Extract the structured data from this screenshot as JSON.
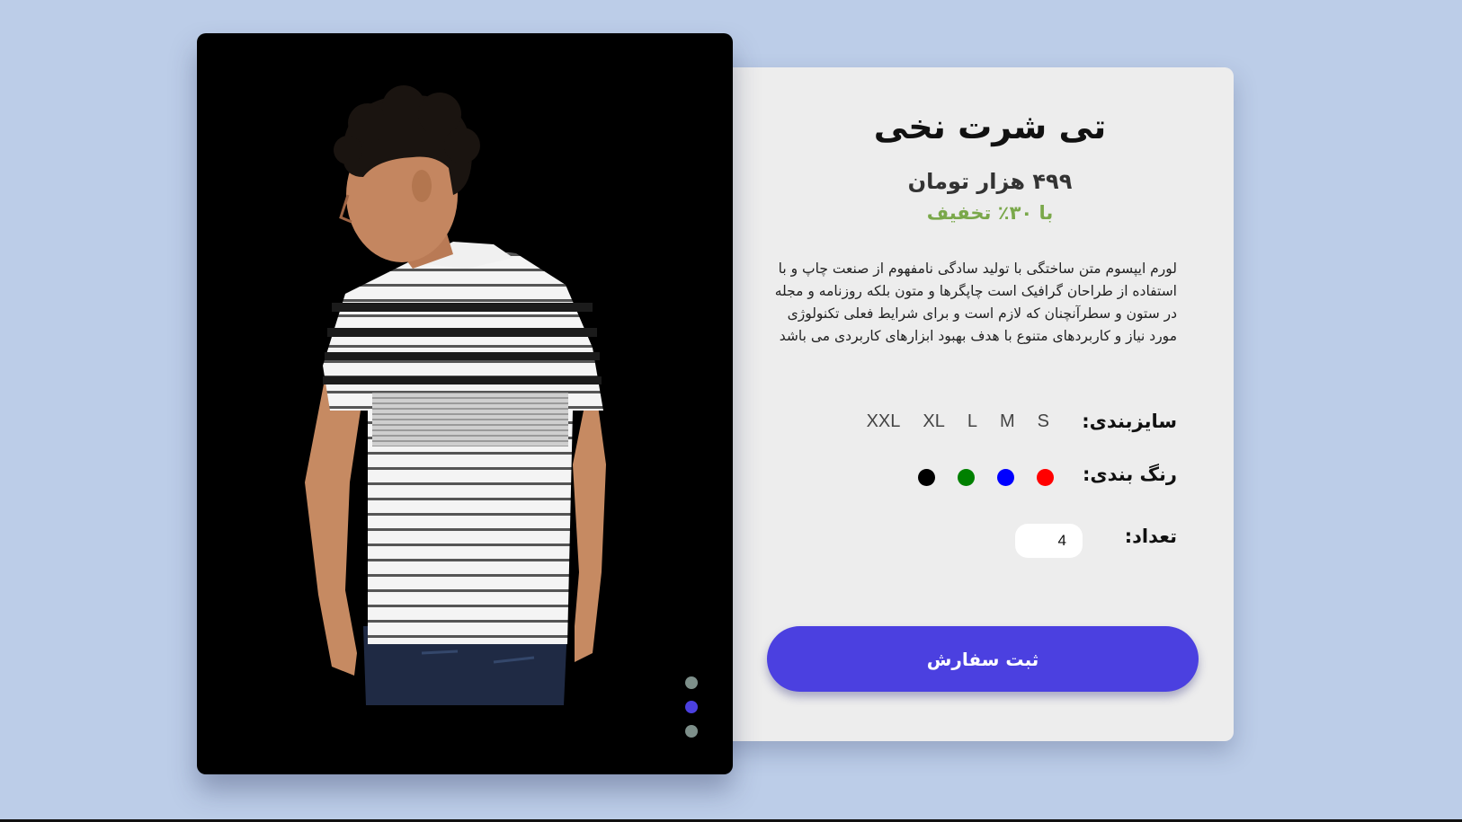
{
  "product": {
    "title": "تی شرت نخی",
    "price": "۴۹۹ هزار تومان",
    "discount": "با ۳۰٪ تخفیف",
    "description": "لورم ایپسوم متن ساختگی با تولید سادگی نامفهوم از صنعت چاپ و با استفاده از طراحان گرافیک است چاپگرها و متون بلکه روزنامه و مجله در ستون و سطرآنچنان که لازم است و برای شرایط فعلی تکنولوژی مورد نیاز و کاربردهای متنوع با هدف بهبود ابزارهای کاربردی می باشد"
  },
  "sizes": {
    "label": "سایزبندی:",
    "options": [
      "S",
      "M",
      "L",
      "XL",
      "XXL"
    ]
  },
  "colors": {
    "label": "رنگ بندی:",
    "options": [
      "#ff0000",
      "#0000ff",
      "#008000",
      "#000000"
    ]
  },
  "quantity": {
    "label": "تعداد:",
    "value": "4"
  },
  "order_button": {
    "label": "ثبت سفارش"
  },
  "gallery": {
    "dots": [
      {
        "color": "#7d8f8a",
        "active": false
      },
      {
        "color": "#4b40e0",
        "active": true
      },
      {
        "color": "#7d8f8a",
        "active": false
      }
    ]
  },
  "theme": {
    "page_bg": "#bccde8",
    "card_bg": "#ededed",
    "accent": "#4b40e0",
    "discount_color": "#7aa84a"
  }
}
